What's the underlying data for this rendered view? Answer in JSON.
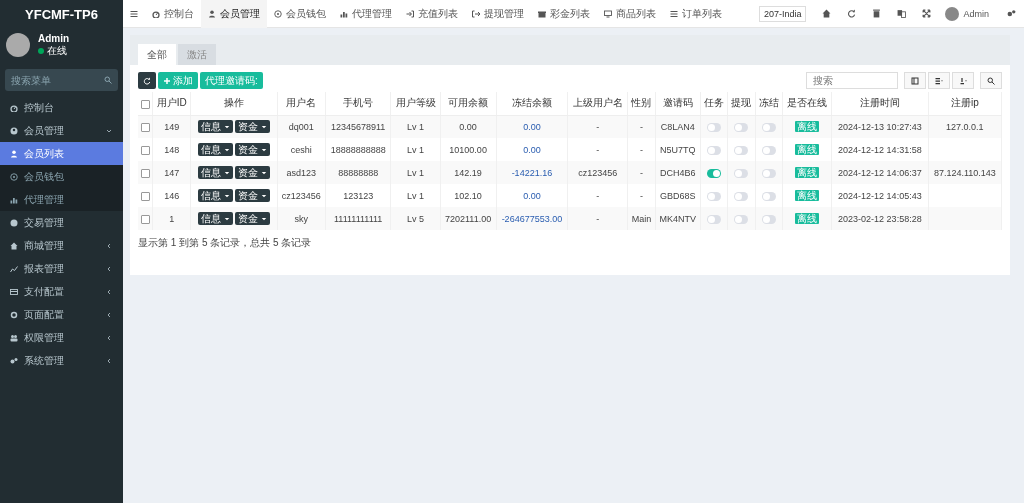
{
  "sidebar": {
    "logo": "YFCMF-TP6",
    "user": {
      "name": "Admin",
      "status": "在线"
    },
    "search": {
      "placeholder": "搜索菜单"
    },
    "items": [
      {
        "label": "控制台",
        "kind": "link"
      },
      {
        "label": "会员管理",
        "kind": "group",
        "expanded": true,
        "children": [
          {
            "label": "会员列表",
            "selected": true
          },
          {
            "label": "会员钱包",
            "selected": false
          },
          {
            "label": "代理管理",
            "selected": false
          }
        ]
      },
      {
        "label": "交易管理",
        "kind": "link"
      },
      {
        "label": "商城管理",
        "kind": "group",
        "expanded": false
      },
      {
        "label": "报表管理",
        "kind": "group",
        "expanded": false
      },
      {
        "label": "支付配置",
        "kind": "group",
        "expanded": false
      },
      {
        "label": "页面配置",
        "kind": "group",
        "expanded": false
      },
      {
        "label": "权限管理",
        "kind": "group",
        "expanded": false
      },
      {
        "label": "系统管理",
        "kind": "group",
        "expanded": false
      }
    ]
  },
  "topbar": {
    "tabs": [
      {
        "label": "控制台",
        "selected": false
      },
      {
        "label": "会员管理",
        "selected": true
      },
      {
        "label": "会员钱包",
        "selected": false
      },
      {
        "label": "代理管理",
        "selected": false
      },
      {
        "label": "充值列表",
        "selected": false
      },
      {
        "label": "提现管理",
        "selected": false
      },
      {
        "label": "彩金列表",
        "selected": false
      },
      {
        "label": "商品列表",
        "selected": false
      },
      {
        "label": "订单列表",
        "selected": false
      }
    ],
    "region": "207-India",
    "admin": "Admin"
  },
  "filter_tabs": [
    {
      "label": "全部",
      "selected": true
    },
    {
      "label": "激活",
      "selected": false
    }
  ],
  "toolbar": {
    "add": "添加",
    "agent_code": "代理邀请码:",
    "search": {
      "placeholder": "搜索"
    }
  },
  "table": {
    "all_selected": false,
    "columns": [
      "用户ID",
      "操作",
      "用户名",
      "手机号",
      "用户等级",
      "可用余额",
      "冻结余额",
      "上级用户名",
      "性别",
      "邀请码",
      "任务",
      "提现",
      "冻结",
      "是否在线",
      "注册时间",
      "注册ip"
    ],
    "rows": [
      {
        "id": "149",
        "actions": [
          "信息",
          "资金"
        ],
        "username": "dq001",
        "phone": "12345678911",
        "level": "Lv 1",
        "balance": "0.00",
        "frozen": "0.00",
        "parent": "-",
        "gender": "-",
        "invite": "C8LAN4",
        "task": false,
        "withdraw": false,
        "freeze": false,
        "online": "离线",
        "time": "2024-12-13 10:27:43",
        "ip": "127.0.0.1",
        "selected": false
      },
      {
        "id": "148",
        "actions": [
          "信息",
          "资金"
        ],
        "username": "ceshi",
        "phone": "18888888888",
        "level": "Lv 1",
        "balance": "10100.00",
        "frozen": "0.00",
        "parent": "-",
        "gender": "-",
        "invite": "N5U7TQ",
        "task": false,
        "withdraw": false,
        "freeze": false,
        "online": "离线",
        "time": "2024-12-12 14:31:58",
        "selected": false
      },
      {
        "id": "147",
        "actions": [
          "信息",
          "资金"
        ],
        "username": "asd123",
        "phone": "88888888",
        "level": "Lv 1",
        "balance": "142.19",
        "frozen": "-14221.16",
        "parent": "cz123456",
        "gender": "-",
        "invite": "DCH4B6",
        "task": true,
        "withdraw": false,
        "freeze": false,
        "online": "离线",
        "time": "2024-12-12 14:06:37",
        "ip": "87.124.110.143",
        "selected": false
      },
      {
        "id": "146",
        "actions": [
          "信息",
          "资金"
        ],
        "username": "cz123456",
        "phone": "123123",
        "level": "Lv 1",
        "balance": "102.10",
        "frozen": "0.00",
        "parent": "-",
        "gender": "-",
        "invite": "GBD68S",
        "task": false,
        "withdraw": false,
        "freeze": false,
        "online": "离线",
        "time": "2024-12-12 14:05:43",
        "selected": false
      },
      {
        "id": "1",
        "actions": [
          "信息",
          "资金"
        ],
        "username": "sky",
        "phone": "11111111111",
        "level": "Lv 5",
        "balance": "7202111.00",
        "frozen": "-264677553.00",
        "parent": "-",
        "gender": "Main",
        "invite": "MK4NTV",
        "task": false,
        "withdraw": false,
        "freeze": false,
        "online": "离线",
        "time": "2023-02-12 23:58:28",
        "selected": false
      }
    ],
    "summary": "显示第 1 到第 5 条记录，总共 5 条记录"
  }
}
